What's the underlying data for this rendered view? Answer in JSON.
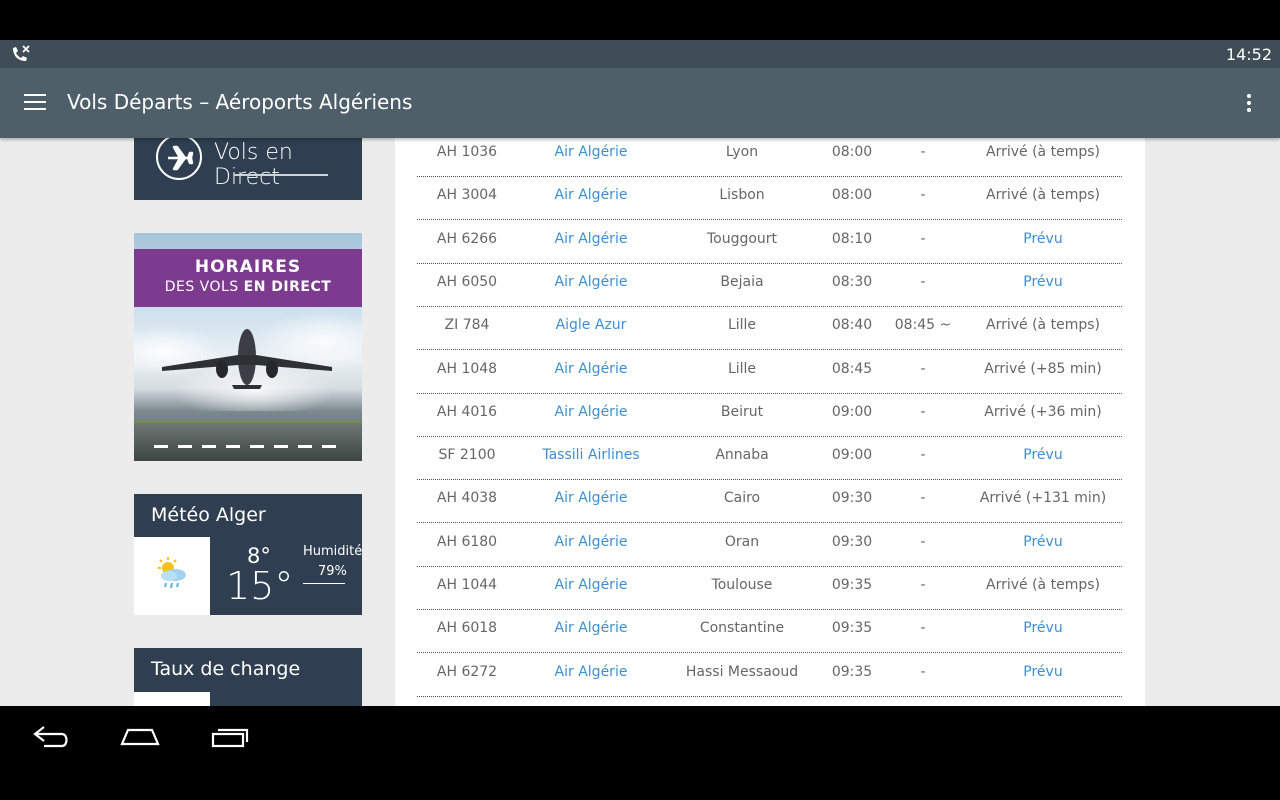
{
  "status_bar": {
    "time": "14:52",
    "call_icon": "missed-call-icon"
  },
  "app_bar": {
    "title": "Vols Départs – Aéroports Algériens",
    "menu_icon": "hamburger-icon",
    "overflow_icon": "more-vert-icon"
  },
  "sidebar": {
    "vols_direct_label": "Vols en Direct",
    "promo": {
      "line1": "HORAIRES",
      "line2_part1": "DES VOLS ",
      "line2_part2": "EN DIRECT"
    },
    "meteo": {
      "title": "Météo Alger",
      "temp_low": "8°",
      "temp_high": "15°",
      "humidity_label": "Humidité",
      "humidity_value": "79%",
      "icon": "sun-cloud-rain-icon"
    },
    "change": {
      "title": "Taux de change"
    }
  },
  "flights": [
    {
      "flight": "AH 1036",
      "airline": "Air Algérie",
      "city": "Lyon",
      "time": "08:00",
      "estimated": "-",
      "status": "Arrivé (à temps)",
      "prevu": false
    },
    {
      "flight": "AH 3004",
      "airline": "Air Algérie",
      "city": "Lisbon",
      "time": "08:00",
      "estimated": "-",
      "status": "Arrivé (à temps)",
      "prevu": false
    },
    {
      "flight": "AH 6266",
      "airline": "Air Algérie",
      "city": "Touggourt",
      "time": "08:10",
      "estimated": "-",
      "status": "Prévu",
      "prevu": true
    },
    {
      "flight": "AH 6050",
      "airline": "Air Algérie",
      "city": "Bejaia",
      "time": "08:30",
      "estimated": "-",
      "status": "Prévu",
      "prevu": true
    },
    {
      "flight": "ZI 784",
      "airline": "Aigle Azur",
      "city": "Lille",
      "time": "08:40",
      "estimated": "08:45 ~",
      "status": "Arrivé (à temps)",
      "prevu": false
    },
    {
      "flight": "AH 1048",
      "airline": "Air Algérie",
      "city": "Lille",
      "time": "08:45",
      "estimated": "-",
      "status": "Arrivé (+85 min)",
      "prevu": false
    },
    {
      "flight": "AH 4016",
      "airline": "Air Algérie",
      "city": "Beirut",
      "time": "09:00",
      "estimated": "-",
      "status": "Arrivé (+36 min)",
      "prevu": false
    },
    {
      "flight": "SF 2100",
      "airline": "Tassili Airlines",
      "city": "Annaba",
      "time": "09:00",
      "estimated": "-",
      "status": "Prévu",
      "prevu": true
    },
    {
      "flight": "AH 4038",
      "airline": "Air Algérie",
      "city": "Cairo",
      "time": "09:30",
      "estimated": "-",
      "status": "Arrivé (+131 min)",
      "prevu": false
    },
    {
      "flight": "AH 6180",
      "airline": "Air Algérie",
      "city": "Oran",
      "time": "09:30",
      "estimated": "-",
      "status": "Prévu",
      "prevu": true
    },
    {
      "flight": "AH 1044",
      "airline": "Air Algérie",
      "city": "Toulouse",
      "time": "09:35",
      "estimated": "-",
      "status": "Arrivé (à temps)",
      "prevu": false
    },
    {
      "flight": "AH 6018",
      "airline": "Air Algérie",
      "city": "Constantine",
      "time": "09:35",
      "estimated": "-",
      "status": "Prévu",
      "prevu": true
    },
    {
      "flight": "AH 6272",
      "airline": "Air Algérie",
      "city": "Hassi Messaoud",
      "time": "09:35",
      "estimated": "-",
      "status": "Prévu",
      "prevu": true
    }
  ],
  "scroll_top_icon": "chevron-up-icon",
  "nav": {
    "back_icon": "back-icon",
    "home_icon": "home-icon",
    "recent_icon": "recent-apps-icon"
  },
  "colors": {
    "app_bar": "#4f5f69",
    "status_bar": "#3f4d56",
    "card_dark": "#2f3e50",
    "link_blue": "#3d8fd1",
    "scroll_button": "#81d4ea",
    "promo_band": "#7d3b8f"
  }
}
